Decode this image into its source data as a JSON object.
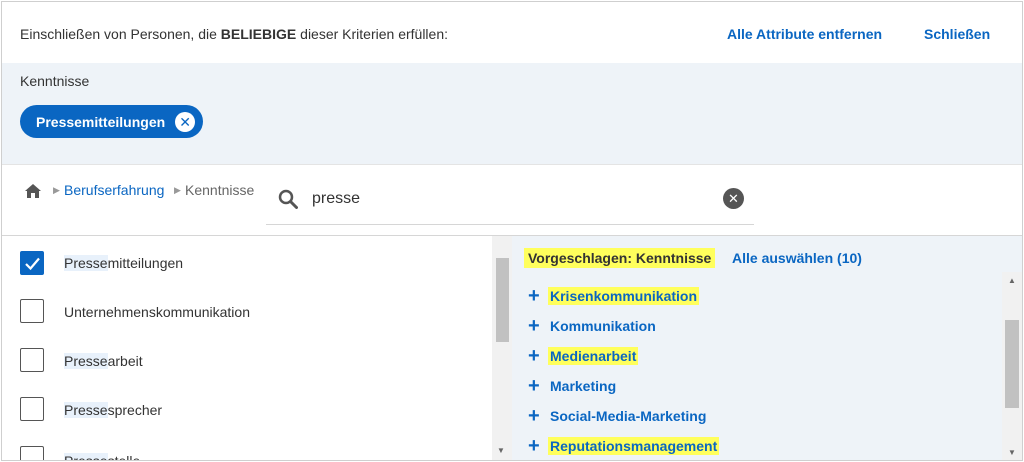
{
  "header": {
    "prefix": "Einschließen von Personen, die ",
    "emphasis": "BELIEBIGE",
    "suffix": " dieser Kriterien erfüllen:",
    "remove_all": "Alle Attribute entfernen",
    "close": "Schließen"
  },
  "selected": {
    "label": "Kenntnisse",
    "pill": "Pressemitteilungen"
  },
  "breadcrumb": {
    "items": [
      "Berufserfahrung",
      "Kenntnisse"
    ]
  },
  "search": {
    "value": "presse",
    "placeholder": ""
  },
  "results": [
    {
      "match": "Presse",
      "rest": "mitteilungen",
      "checked": true
    },
    {
      "match": "",
      "rest": "Unternehmenskommunikation",
      "checked": false
    },
    {
      "match": "Presse",
      "rest": "arbeit",
      "checked": false
    },
    {
      "match": "Presse",
      "rest": "sprecher",
      "checked": false
    },
    {
      "match": "Presse",
      "rest": "stelle",
      "checked": false
    }
  ],
  "suggestions": {
    "title": "Vorgeschlagen: Kenntnisse",
    "select_all": "Alle auswählen (10)",
    "items": [
      {
        "label": "Krisenkommunikation",
        "highlight": true
      },
      {
        "label": "Kommunikation",
        "highlight": false
      },
      {
        "label": "Medienarbeit",
        "highlight": true
      },
      {
        "label": "Marketing",
        "highlight": false
      },
      {
        "label": "Social-Media-Marketing",
        "highlight": false
      },
      {
        "label": "Reputationsmanagement",
        "highlight": true
      }
    ]
  },
  "icons": {
    "home": "home-icon",
    "search": "search-icon",
    "clear": "clear-icon",
    "pill_remove": "close-circle-icon",
    "check": "checkmark-icon",
    "plus": "plus-icon"
  },
  "colors": {
    "accent": "#0a66c2",
    "band": "#eef3f8",
    "highlight": "#ffff5c"
  }
}
